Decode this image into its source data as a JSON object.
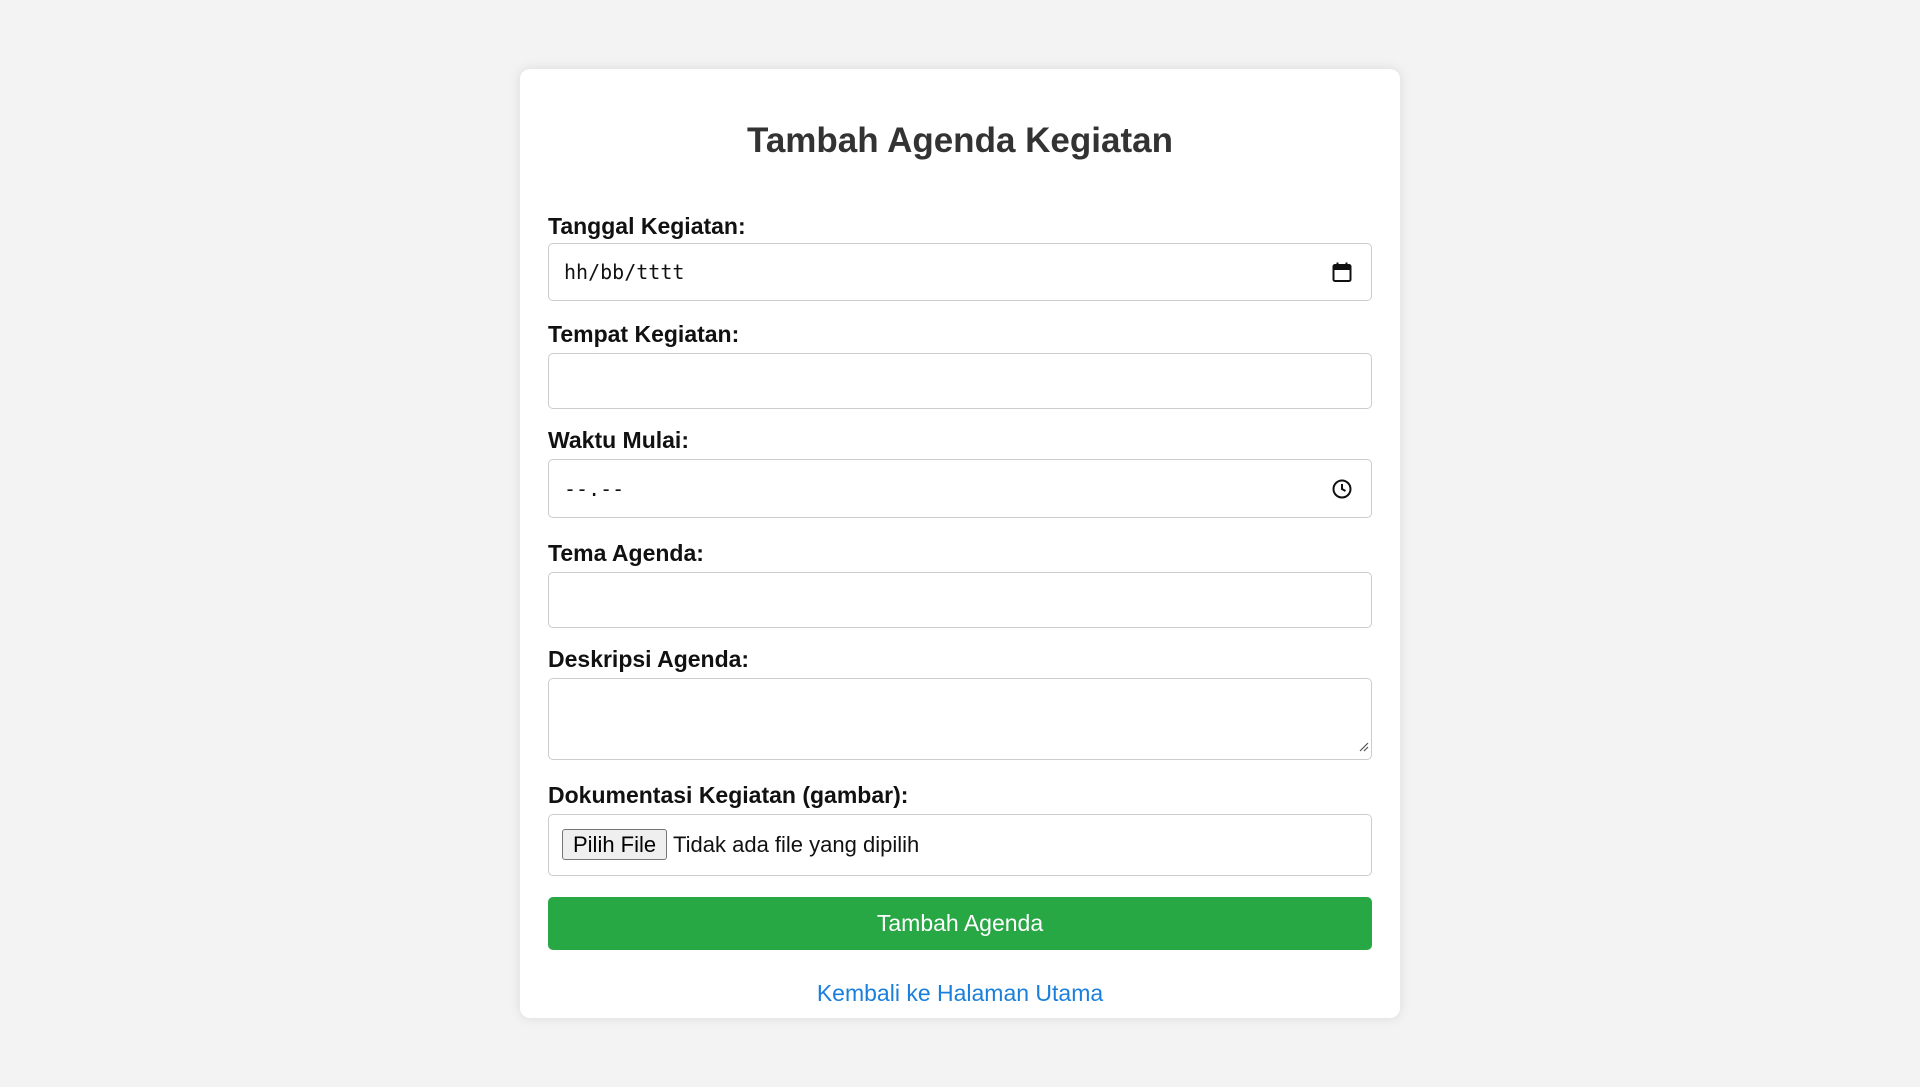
{
  "form": {
    "title": "Tambah Agenda Kegiatan",
    "tanggal": {
      "label": "Tanggal Kegiatan:",
      "placeholder": "hh/bb/tttt",
      "icon": "calendar-icon"
    },
    "tempat": {
      "label": "Tempat Kegiatan:",
      "value": ""
    },
    "waktu": {
      "label": "Waktu Mulai:",
      "placeholder": "--.--",
      "icon": "clock-icon"
    },
    "tema": {
      "label": "Tema Agenda:",
      "value": ""
    },
    "deskripsi": {
      "label": "Deskripsi Agenda:",
      "value": ""
    },
    "dokumentasi": {
      "label": "Dokumentasi Kegiatan (gambar):",
      "button_label": "Pilih File",
      "status": "Tidak ada file yang dipilih"
    },
    "submit_label": "Tambah Agenda",
    "back_link": "Kembali ke Halaman Utama"
  },
  "colors": {
    "page_background": "#f3f3f3",
    "card_background": "#ffffff",
    "submit_button": "#28a745",
    "link": "#1a7fdc"
  }
}
